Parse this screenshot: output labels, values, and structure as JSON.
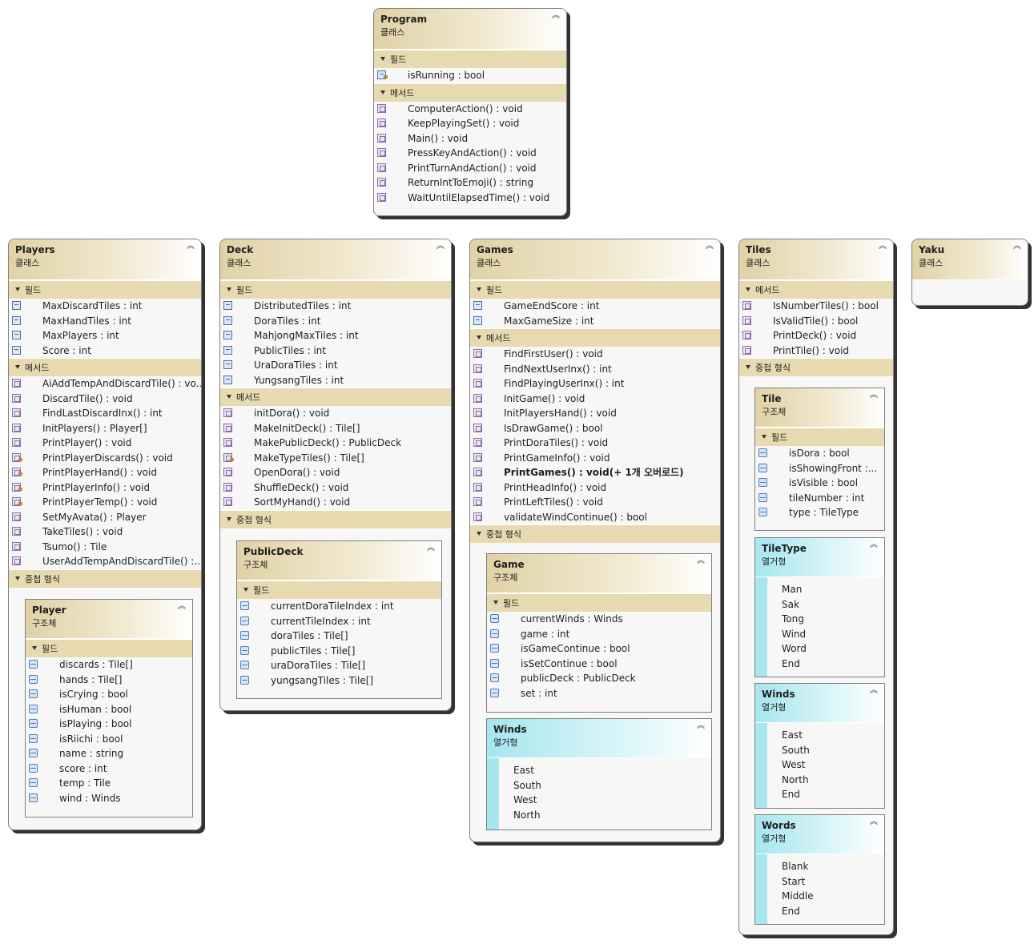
{
  "labels": {
    "fields": "필드",
    "methods": "메서드",
    "nested": "중첩 형식",
    "class": "클래스",
    "struct": "구조체",
    "enum": "열거형"
  },
  "program": {
    "title": "Program",
    "fields": [
      "isRunning : bool"
    ],
    "methods": [
      "ComputerAction() : void",
      "KeepPlayingSet() : void",
      "Main() : void",
      "PressKeyAndAction() : void",
      "PrintTurnAndAction() : void",
      "ReturnIntToEmoji() : string",
      "WaitUntilElapsedTime() : void"
    ]
  },
  "players": {
    "title": "Players",
    "fields": [
      "MaxDiscardTiles : int",
      "MaxHandTiles : int",
      "MaxPlayers : int",
      "Score : int"
    ],
    "methods": [
      "AiAddTempAndDiscardTile()  :  vo...",
      "DiscardTile() : void",
      "FindLastDiscardInx() : int",
      "InitPlayers() : Player[]",
      "PrintPlayer() : void",
      "PrintPlayerDiscards() : void",
      "PrintPlayerHand() : void",
      "PrintPlayerInfo() : void",
      "PrintPlayerTemp() : void",
      "SetMyAvata() : Player",
      "TakeTiles() : void",
      "Tsumo() : Tile",
      "UserAddTempAndDiscardTile()  :..."
    ],
    "player": {
      "title": "Player",
      "fields": [
        "discards : Tile[]",
        "hands : Tile[]",
        "isCrying : bool",
        "isHuman : bool",
        "isPlaying : bool",
        "isRiichi : bool",
        "name : string",
        "score : int",
        "temp : Tile",
        "wind : Winds"
      ]
    }
  },
  "deck": {
    "title": "Deck",
    "fields": [
      "DistributedTiles : int",
      "DoraTiles : int",
      "MahjongMaxTiles : int",
      "PublicTiles : int",
      "UraDoraTiles : int",
      "YungsangTiles : int"
    ],
    "methods": [
      "initDora() : void",
      "MakeInitDeck() : Tile[]",
      "MakePublicDeck() : PublicDeck",
      "MakeTypeTiles() : Tile[]",
      "OpenDora() : void",
      "ShuffleDeck() : void",
      "SortMyHand() : void"
    ],
    "publicdeck": {
      "title": "PublicDeck",
      "fields": [
        "currentDoraTileIndex : int",
        "currentTileIndex : int",
        "doraTiles : Tile[]",
        "publicTiles : Tile[]",
        "uraDoraTiles : Tile[]",
        "yungsangTiles : Tile[]"
      ]
    }
  },
  "games": {
    "title": "Games",
    "fields": [
      "GameEndScore : int",
      "MaxGameSize : int"
    ],
    "methods": [
      "FindFirstUser() : void",
      "FindNextUserInx() : int",
      "FindPlayingUserInx() : int",
      "InitGame() : void",
      "InitPlayersHand() : void",
      "IsDrawGame() : bool",
      "PrintDoraTiles() : void",
      "PrintGameInfo() : void",
      "PrintGames() : void(+ 1개 오버로드)",
      "PrintHeadInfo() : void",
      "PrintLeftTiles() : void",
      "validateWindContinue() : bool"
    ],
    "game": {
      "title": "Game",
      "fields": [
        "currentWinds : Winds",
        "game : int",
        "isGameContinue : bool",
        "isSetContinue : bool",
        "publicDeck : PublicDeck",
        "set : int"
      ]
    },
    "winds": {
      "title": "Winds",
      "values": [
        "East",
        "South",
        "West",
        "North"
      ]
    }
  },
  "tiles": {
    "title": "Tiles",
    "methods": [
      "IsNumberTiles() : bool",
      "IsValidTile() : bool",
      "PrintDeck() : void",
      "PrintTile() : void"
    ],
    "tile": {
      "title": "Tile",
      "fields": [
        "isDora : bool",
        "isShowingFront  :...",
        "isVisible : bool",
        "tileNumber : int",
        "type : TileType"
      ]
    },
    "tiletype": {
      "title": "TileType",
      "values": [
        "Man",
        "Sak",
        "Tong",
        "Wind",
        "Word",
        "End"
      ]
    },
    "winds": {
      "title": "Winds",
      "values": [
        "East",
        "South",
        "West",
        "North",
        "End"
      ]
    },
    "words": {
      "title": "Words",
      "values": [
        "Blank",
        "Start",
        "Middle",
        "End"
      ]
    }
  },
  "yaku": {
    "title": "Yaku"
  },
  "icons": {
    "collapse": "chevron-up-icon",
    "field": "field-icon",
    "method": "method-icon",
    "struct-field": "struct-field-icon"
  }
}
